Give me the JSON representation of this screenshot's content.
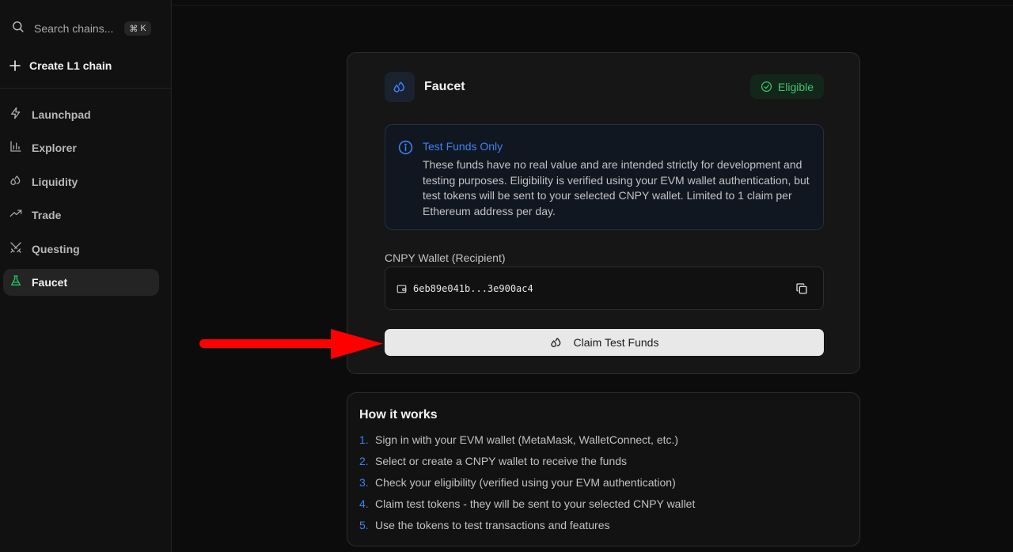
{
  "sidebar": {
    "search_placeholder": "Search chains...",
    "search_shortcut_symbol": "⌘",
    "search_shortcut_key": "K",
    "create_label": "Create L1 chain",
    "items": [
      {
        "label": "Launchpad",
        "icon": "lightning-icon",
        "active": false
      },
      {
        "label": "Explorer",
        "icon": "bar-chart-icon",
        "active": false
      },
      {
        "label": "Liquidity",
        "icon": "droplets-icon",
        "active": false
      },
      {
        "label": "Trade",
        "icon": "trending-up-icon",
        "active": false
      },
      {
        "label": "Questing",
        "icon": "swords-icon",
        "active": false
      },
      {
        "label": "Faucet",
        "icon": "flask-icon",
        "active": true
      }
    ]
  },
  "faucet": {
    "title": "Faucet",
    "badge": "Eligible",
    "info_title": "Test Funds Only",
    "info_text": "These funds have no real value and are intended strictly for development and testing purposes. Eligibility is verified using your EVM wallet authentication, but test tokens will be sent to your selected CNPY wallet. Limited to 1 claim per Ethereum address per day.",
    "wallet_label": "CNPY Wallet (Recipient)",
    "wallet_address": "6eb89e041b...3e900ac4",
    "claim_label": "Claim Test Funds"
  },
  "how_it_works": {
    "title": "How it works",
    "steps": [
      {
        "num": "1.",
        "text": "Sign in with your EVM wallet (MetaMask, WalletConnect, etc.)"
      },
      {
        "num": "2.",
        "text": "Select or create a CNPY wallet to receive the funds"
      },
      {
        "num": "3.",
        "text": "Check your eligibility (verified using your EVM authentication)"
      },
      {
        "num": "4.",
        "text": "Claim test tokens - they will be sent to your selected CNPY wallet"
      },
      {
        "num": "5.",
        "text": "Use the tokens to test transactions and features"
      }
    ]
  },
  "colors": {
    "accent_blue": "#3b82f6",
    "eligible_green": "#3ec46d",
    "faucet_active_green": "#22c55e",
    "annotation_arrow": "#ff0000"
  }
}
